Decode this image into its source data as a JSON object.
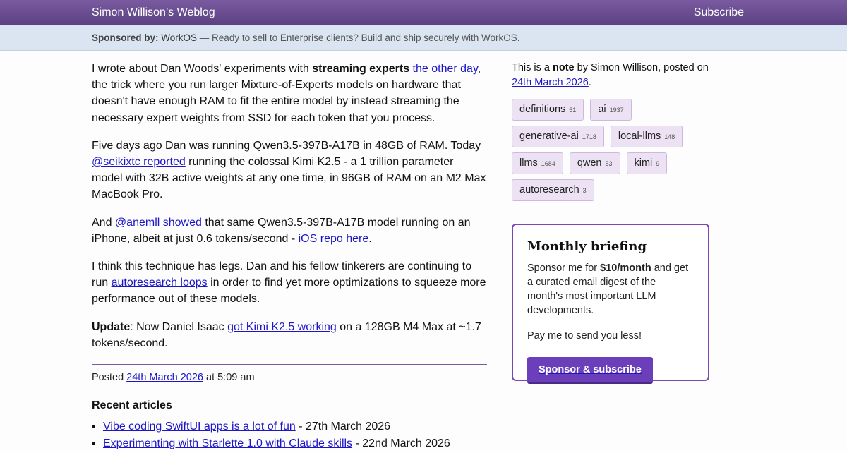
{
  "header": {
    "site_title": "Simon Willison’s Weblog",
    "subscribe": "Subscribe"
  },
  "sponsor": {
    "label": "Sponsored by:",
    "link": "WorkOS",
    "text": " — Ready to sell to Enterprise clients? Build and ship securely with WorkOS."
  },
  "article": {
    "p1": {
      "t1": "I wrote about Dan Woods' experiments with ",
      "bold": "streaming experts",
      "t2": " ",
      "link": "the other day",
      "t3": ", the trick where you run larger Mixture-of-Experts models on hardware that doesn't have enough RAM to fit the entire model by instead streaming the necessary expert weights from SSD for each token that you process."
    },
    "p2": {
      "t1": "Five days ago Dan was running Qwen3.5-397B-A17B in 48GB of RAM. Today ",
      "link": "@seikixtc reported",
      "t2": " running the colossal Kimi K2.5 - a 1 trillion parameter model with 32B active weights at any one time, in 96GB of RAM on an M2 Max MacBook Pro."
    },
    "p3": {
      "t1": "And ",
      "link1": "@anemll showed",
      "t2": " that same Qwen3.5-397B-A17B model running on an iPhone, albeit at just 0.6 tokens/second - ",
      "link2": "iOS repo here",
      "t3": "."
    },
    "p4": {
      "t1": "I think this technique has legs. Dan and his fellow tinkerers are continuing to run ",
      "link": "autoresearch loops",
      "t2": " in order to find yet more optimizations to squeeze more performance out of these models."
    },
    "p5": {
      "bold": "Update",
      "t1": ": Now Daniel Isaac ",
      "link": "got Kimi K2.5 working",
      "t2": " on a 128GB M4 Max at ~1.7 tokens/second."
    },
    "posted": {
      "label": "Posted ",
      "date": "24th March 2026",
      "time": " at 5:09 am"
    }
  },
  "recent": {
    "heading": "Recent articles",
    "items": [
      {
        "title": "Vibe coding SwiftUI apps is a lot of fun",
        "date": " - 27th March 2026"
      },
      {
        "title": "Experimenting with Starlette 1.0 with Claude skills",
        "date": " - 22nd March 2026"
      }
    ]
  },
  "sidebar": {
    "note": {
      "t1": "This is a ",
      "bold": "note",
      "t2": " by Simon Willison, posted on ",
      "date": "24th March 2026",
      "t3": "."
    },
    "tags": [
      {
        "name": "definitions",
        "count": "51"
      },
      {
        "name": "ai",
        "count": "1937"
      },
      {
        "name": "generative-ai",
        "count": "1718"
      },
      {
        "name": "local-llms",
        "count": "148"
      },
      {
        "name": "llms",
        "count": "1684"
      },
      {
        "name": "qwen",
        "count": "53"
      },
      {
        "name": "kimi",
        "count": "9"
      },
      {
        "name": "autoresearch",
        "count": "3"
      }
    ],
    "briefing": {
      "title": "Monthly briefing",
      "p1_t1": "Sponsor me for ",
      "p1_bold": "$10/month",
      "p1_t2": " and get a curated email digest of the month's most important LLM developments.",
      "p2": "Pay me to send you less!",
      "button": "Sponsor & subscribe"
    }
  }
}
